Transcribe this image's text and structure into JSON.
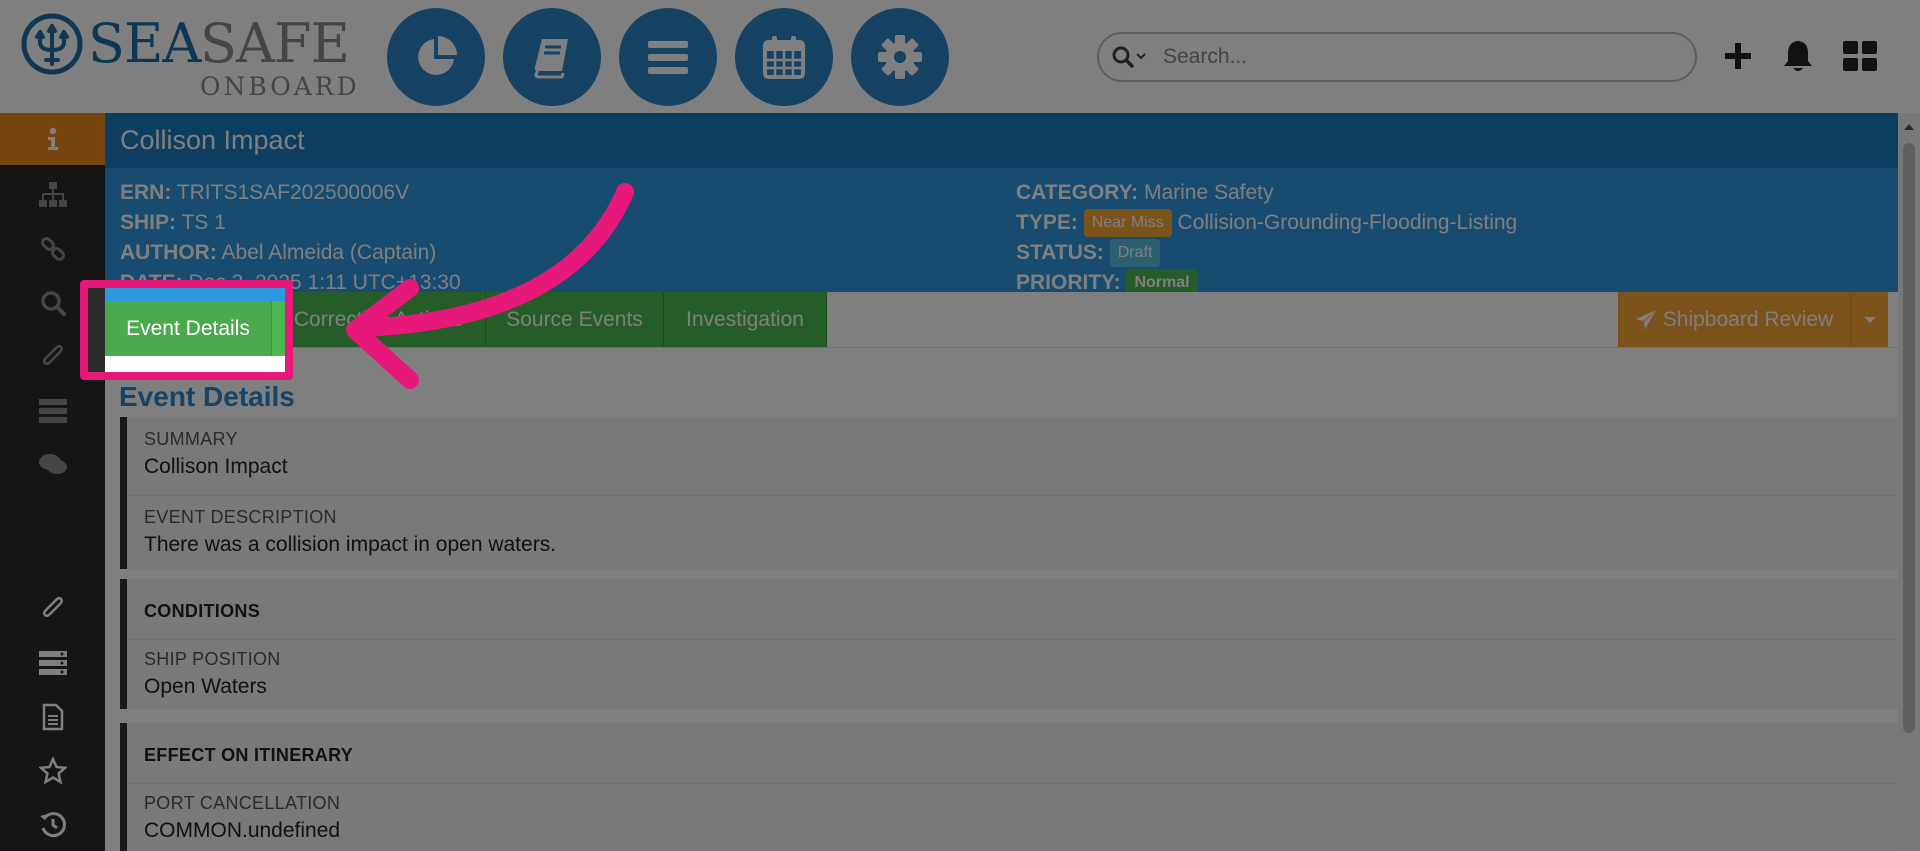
{
  "header": {
    "logo": {
      "sea": "SEA",
      "safe": "SAFE",
      "onboard": "ONBOARD"
    },
    "nav_buttons": [
      {
        "name": "dashboard",
        "icon": "pie-chart-icon"
      },
      {
        "name": "manuals",
        "icon": "book-icon"
      },
      {
        "name": "menu",
        "icon": "hamburger-menu-icon"
      },
      {
        "name": "calendar",
        "icon": "calendar-icon"
      },
      {
        "name": "settings",
        "icon": "gear-icon"
      }
    ],
    "search": {
      "placeholder": "Search...",
      "icon": "search-icon"
    },
    "actions": [
      "plus-icon",
      "bell-icon",
      "grid-icon"
    ]
  },
  "sidebar": {
    "items": [
      {
        "icon": "info-icon",
        "active": true
      },
      {
        "icon": "sitemap-icon"
      },
      {
        "icon": "link-icon"
      },
      {
        "icon": "search-icon"
      },
      {
        "icon": "paperclip-icon"
      },
      {
        "icon": "server-icon"
      },
      {
        "icon": "comments-icon"
      },
      {
        "icon": "paperclip-icon"
      },
      {
        "icon": "server-icon"
      },
      {
        "icon": "document-icon"
      },
      {
        "icon": "star-icon"
      },
      {
        "icon": "history-icon"
      }
    ]
  },
  "event": {
    "title": "Collison Impact",
    "ern_label": "ERN:",
    "ern": "TRITS1SAF202500006V",
    "ship_label": "SHIP:",
    "ship": "TS 1",
    "author_label": "AUTHOR:",
    "author": "Abel Almeida (Captain)",
    "date_label": "DATE:",
    "date": "Dec 3, 2025 1:11 UTC+13:30",
    "category_label": "CATEGORY:",
    "category": "Marine Safety",
    "type_label": "TYPE:",
    "type_badge": "Near Miss",
    "type": "Collision-Grounding-Flooding-Listing",
    "status_label": "STATUS:",
    "status": "Draft",
    "priority_label": "PRIORITY:",
    "priority": "Normal"
  },
  "tabs": [
    {
      "label": "Event Details",
      "active": true
    },
    {
      "label": "Corrective Actions"
    },
    {
      "label": "Source Events"
    },
    {
      "label": "Investigation"
    }
  ],
  "review_button": {
    "label": "Shipboard Review",
    "icon": "paper-plane-icon"
  },
  "section_title": "Event Details",
  "fields": {
    "summary_label": "SUMMARY",
    "summary": "Collison Impact",
    "description_label": "EVENT DESCRIPTION",
    "description": "There was a collision impact in open waters.",
    "conditions_head": "CONDITIONS",
    "ship_position_label": "SHIP POSITION",
    "ship_position": "Open Waters",
    "itinerary_head": "EFFECT ON ITINERARY",
    "port_cancellation_label": "PORT CANCELLATION",
    "port_cancellation": "COMMON.undefined"
  },
  "colors": {
    "brand_blue": "#2c84c7",
    "header_blue": "#1b7dc0",
    "meta_blue": "#2e97df",
    "tab_green": "#4cb84f",
    "orange": "#f6a532",
    "highlight_pink": "#e6197a",
    "sidebar": "#2b2b2b"
  }
}
